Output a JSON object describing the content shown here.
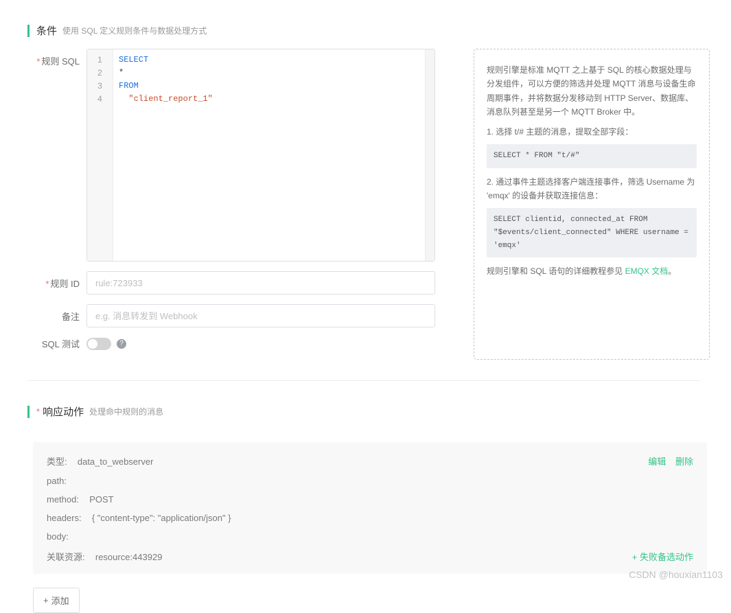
{
  "condition": {
    "title": "条件",
    "subtitle": "使用 SQL 定义规则条件与数据处理方式",
    "sql_label": "规则 SQL",
    "sql": {
      "l1": "SELECT",
      "l2": "*",
      "l3": "FROM",
      "l4": "\"client_report_1\""
    },
    "rule_id_label": "规则 ID",
    "rule_id": "rule:723933",
    "remark_label": "备注",
    "remark_placeholder": "e.g. 消息转发到 Webhook",
    "sql_test_label": "SQL 测试"
  },
  "info": {
    "p1": "规则引擎是标准 MQTT 之上基于 SQL 的核心数据处理与分发组件，可以方便的筛选并处理 MQTT 消息与设备生命周期事件，并将数据分发移动到 HTTP Server、数据库、消息队列甚至是另一个 MQTT Broker 中。",
    "n1": "1. 选择 t/# 主题的消息，提取全部字段：",
    "c1": "SELECT * FROM \"t/#\"",
    "n2": "2. 通过事件主题选择客户端连接事件，筛选 Username 为 'emqx' 的设备并获取连接信息：",
    "c2": "SELECT clientid, connected_at FROM \"$events/client_connected\" WHERE username = 'emqx'",
    "p2_pre": "规则引擎和 SQL 语句的详细教程参见 ",
    "p2_link": "EMQX 文档",
    "p2_post": "。"
  },
  "response": {
    "title": "响应动作",
    "subtitle": "处理命中规则的消息",
    "type_label": "类型:",
    "type": "data_to_webserver",
    "path_label": "path:",
    "path": "",
    "method_label": "method:",
    "method": "POST",
    "headers_label": "headers:",
    "headers": "{ \"content-type\": \"application/json\" }",
    "body_label": "body:",
    "body": "",
    "resource_label": "关联资源:",
    "resource": "resource:443929",
    "edit": "编辑",
    "delete": "删除",
    "fallback": "+ 失败备选动作",
    "add": "添加"
  },
  "watermark": "CSDN @houxian1103"
}
